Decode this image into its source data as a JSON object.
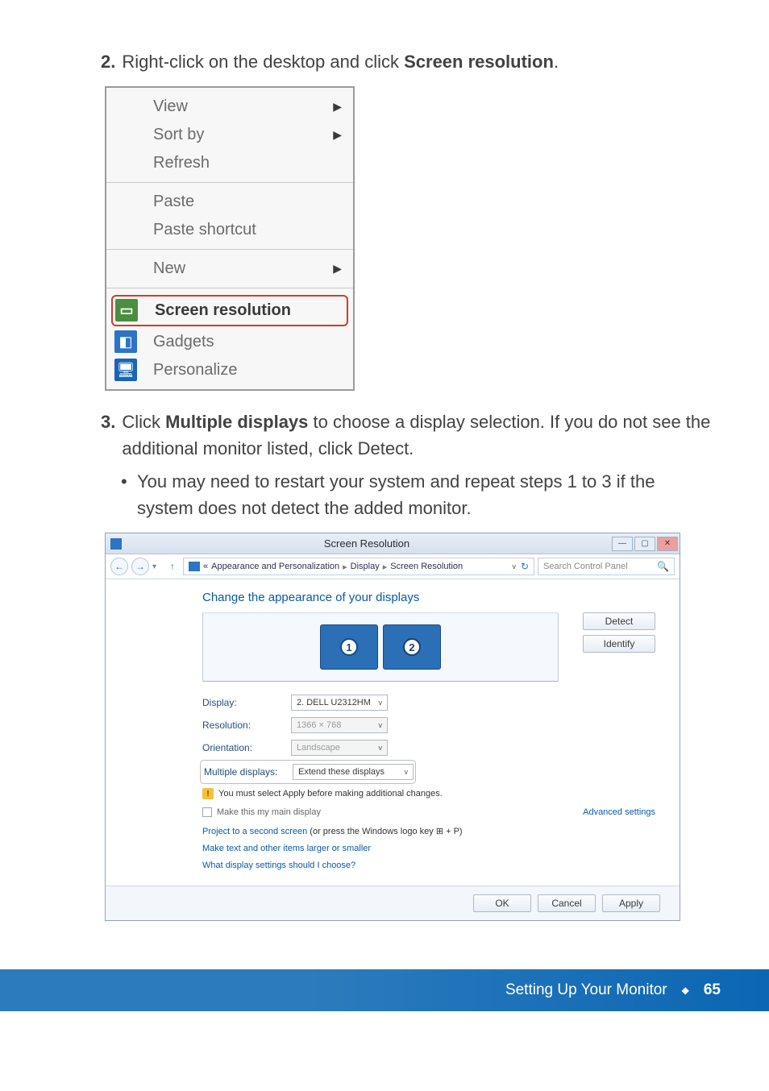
{
  "steps": {
    "s2": {
      "num": "2.",
      "pre": "Right-click on the desktop and click ",
      "bold": "Screen resolution",
      "post": "."
    },
    "s3": {
      "num": "3.",
      "pre": "Click ",
      "bold": "Multiple displays",
      "post": " to choose a display selection. If you do not see the additional monitor listed, click Detect."
    },
    "bullet1": "You may need to restart your system and repeat steps 1 to 3 if the system does not detect the added monitor."
  },
  "ctx_menu": {
    "view": "View",
    "sortby": "Sort by",
    "refresh": "Refresh",
    "paste": "Paste",
    "paste_shortcut": "Paste shortcut",
    "new": "New",
    "screen_resolution": "Screen resolution",
    "gadgets": "Gadgets",
    "personalize": "Personalize"
  },
  "screenres": {
    "title": "Screen Resolution",
    "breadcrumb": {
      "chevrons": "«",
      "seg1": "Appearance and Personalization",
      "seg2": "Display",
      "seg3": "Screen Resolution"
    },
    "search_placeholder": "Search Control Panel",
    "heading": "Change the appearance of your displays",
    "monitors": [
      "1",
      "2"
    ],
    "buttons": {
      "detect": "Detect",
      "identify": "Identify"
    },
    "fields": {
      "display": {
        "label": "Display:",
        "value": "2. DELL U2312HM"
      },
      "resolution": {
        "label": "Resolution:",
        "value": "1366 × 768"
      },
      "orientation": {
        "label": "Orientation:",
        "value": "Landscape"
      },
      "multiple": {
        "label": "Multiple displays:",
        "value": "Extend these displays"
      }
    },
    "warning": "You must select Apply before making additional changes.",
    "make_main": "Make this my main display",
    "advanced": "Advanced settings",
    "links": {
      "project_link": "Project to a second screen",
      "project_trail": " (or press the Windows logo key ⊞ + P)",
      "text_size": "Make text and other items larger or smaller",
      "what_settings": "What display settings should I choose?"
    },
    "footer": {
      "ok": "OK",
      "cancel": "Cancel",
      "apply": "Apply"
    }
  },
  "page_footer": {
    "title": "Setting Up Your Monitor",
    "page": "65"
  }
}
